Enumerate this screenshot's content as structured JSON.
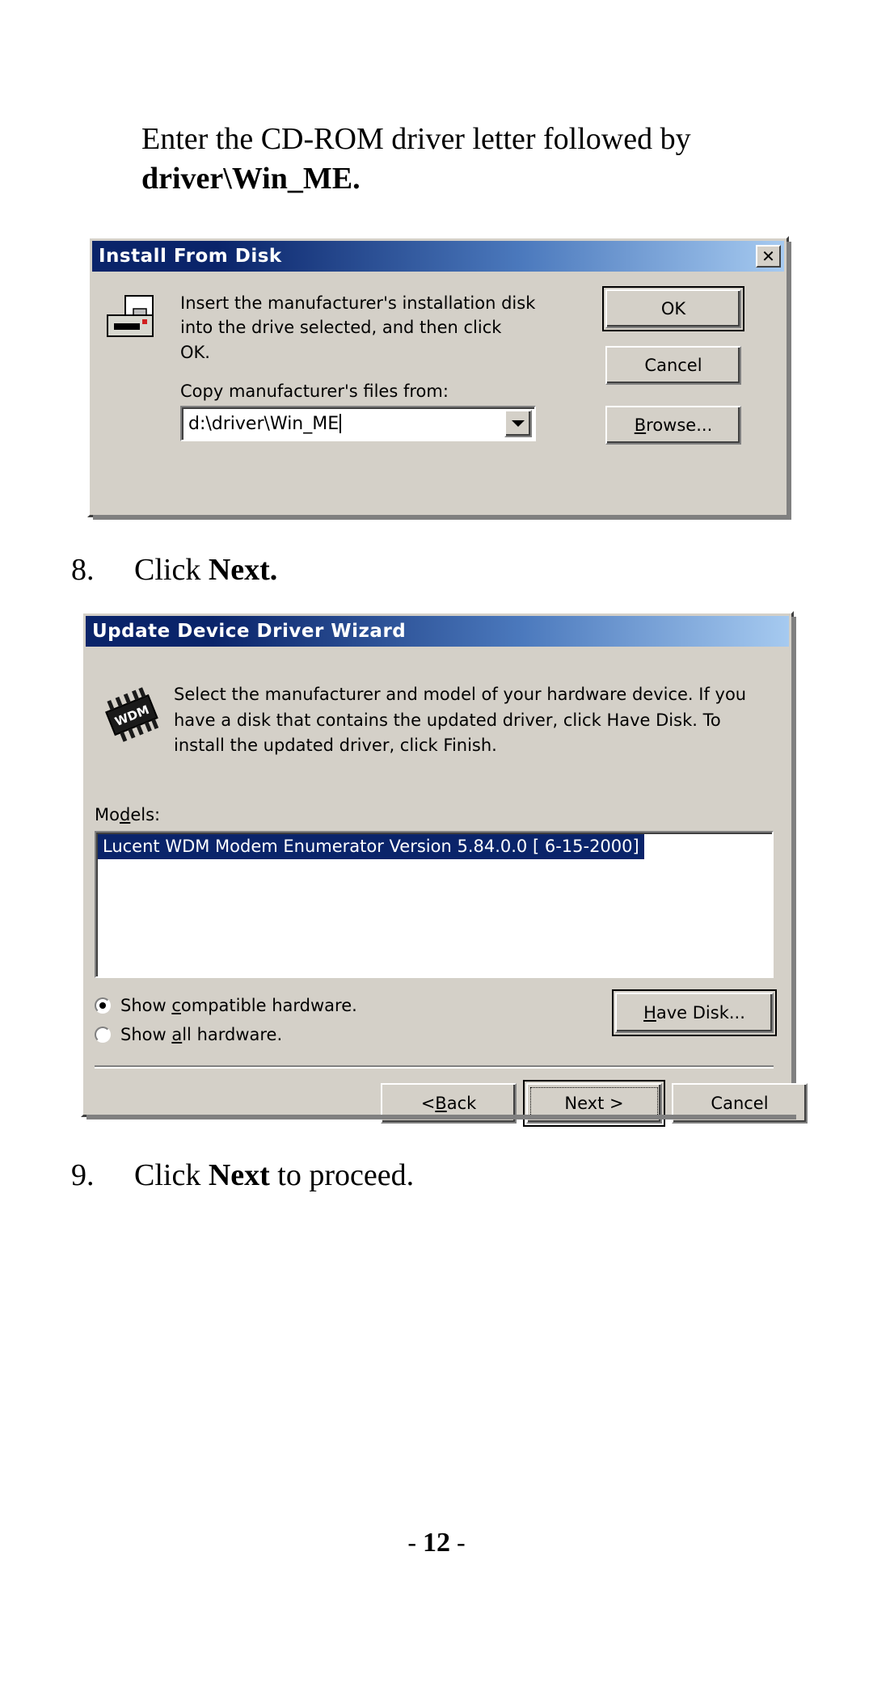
{
  "document": {
    "intro_text_line1": "Enter the CD-ROM driver letter followed by ",
    "intro_text_bold": "driver\\Win_ME.",
    "step8": {
      "number": "8.",
      "text_before": "Click ",
      "text_bold": "Next.",
      "text_after": ""
    },
    "step9": {
      "number": "9.",
      "text_before": "Click ",
      "text_bold": "Next",
      "text_after": " to proceed."
    },
    "page_number_prefix": "- ",
    "page_number": "12",
    "page_number_suffix": " -"
  },
  "install_dialog": {
    "title": "Install From Disk",
    "close_label": "✕",
    "icon_name": "floppy-drive-icon",
    "message": "Insert the manufacturer's installation disk into the drive selected, and then click OK.",
    "ok_label": "OK",
    "cancel_label": "Cancel",
    "copy_from_label": "Copy manufacturer's files from:",
    "path_value": "d:\\driver\\Win_ME",
    "browse_label_acc": "B",
    "browse_label_rest": "rowse..."
  },
  "wizard_dialog": {
    "title": "Update Device Driver Wizard",
    "icon_name": "wdm-chip-icon",
    "icon_text": "WDM",
    "message": "Select the manufacturer and model of your hardware device. If you have a disk that contains the updated driver, click Have Disk. To install the updated driver, click Finish.",
    "models_label_pre": "Mo",
    "models_label_acc": "d",
    "models_label_post": "els:",
    "models_items": [
      "Lucent WDM Modem Enumerator Version 5.84.0.0 [ 6-15-2000]"
    ],
    "radio_compatible": {
      "pre": "Show ",
      "acc": "c",
      "post": "ompatible hardware.",
      "checked": true
    },
    "radio_all": {
      "pre": "Show ",
      "acc": "a",
      "post": "ll hardware.",
      "checked": false
    },
    "have_disk_acc": "H",
    "have_disk_rest": "ave Disk...",
    "back_pre": "< ",
    "back_acc": "B",
    "back_rest": "ack",
    "next_label": "Next >",
    "cancel_label": "Cancel"
  },
  "colors": {
    "title_active_left": "#0a246a",
    "title_active_right": "#a6caf0",
    "dialog_face": "#d4d0c8",
    "selection_blue": "#0a246a",
    "text": "#000000"
  }
}
